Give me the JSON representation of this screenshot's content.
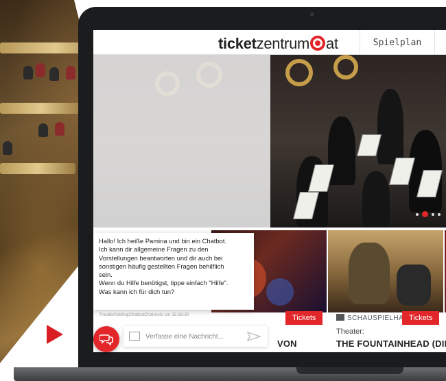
{
  "site": {
    "logo_bold": "ticket",
    "logo_light": "zentrum",
    "logo_suffix": "at",
    "nav": [
      "Spielplan"
    ]
  },
  "cards": [
    {
      "tickets": "Tickets",
      "title": "VON"
    },
    {
      "venue": "SCHAUSPIELHAUS",
      "tickets": "Tickets",
      "kind": "Theater:",
      "title": "THE FOUNTAINHEAD (DIE"
    },
    {
      "tickets": ""
    }
  ],
  "chat": {
    "lines": [
      "Hallo! Ich heiße Pamina und bin ein Chatbot.",
      "Ich kann dir allgemeine Fragen zu den",
      "Vorstellungen beantworten und dir auch bei",
      "sonstigen häufig gestellten Fragen behilflich",
      "sein.",
      "Wenn du Hilfe benötigst, tippe einfach \"Hilfe\".",
      "Was kann ich für dich tun?"
    ],
    "meta": "TheaterholdingChatbotChannels um 15:36:30",
    "placeholder": "Verfasse eine Nachricht..."
  },
  "colors": {
    "brand": "#e2262a",
    "laptop": "#1b1c1e"
  },
  "icons": [
    "chat-bubbles-icon",
    "image-icon",
    "send-icon",
    "building-icon",
    "play-arrow-icon"
  ],
  "hero": {
    "slide_index": 1,
    "slide_count": 4
  }
}
